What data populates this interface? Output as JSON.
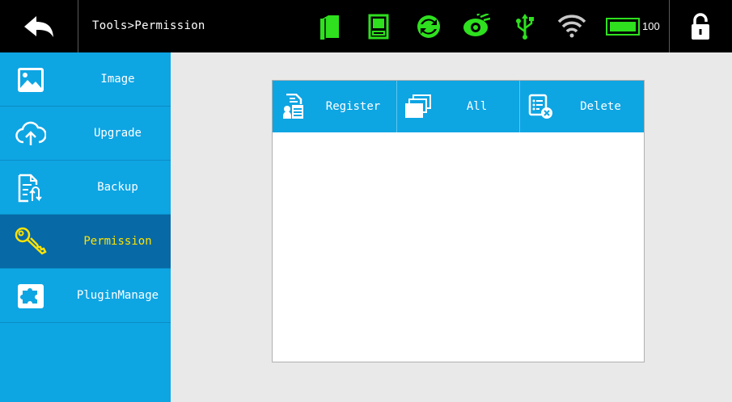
{
  "header": {
    "title": "Tools>Permission",
    "battery_level": "100",
    "status_icons": [
      "printhead-icon",
      "device-icon",
      "sync-icon",
      "eye-icon",
      "usb-icon",
      "wifi-icon",
      "battery-icon"
    ],
    "colors": {
      "status_green": "#2ee01e",
      "background": "#000000"
    }
  },
  "sidebar": {
    "items": [
      {
        "label": "Image",
        "icon": "image-icon"
      },
      {
        "label": "Upgrade",
        "icon": "cloud-upload-icon"
      },
      {
        "label": "Backup",
        "icon": "backup-icon"
      },
      {
        "label": "Permission",
        "icon": "key-icon",
        "active": true
      },
      {
        "label": "PluginManage",
        "icon": "puzzle-icon"
      }
    ],
    "colors": {
      "background": "#0ea5e3",
      "active_background": "#0769a6",
      "active_text": "#ffe300"
    }
  },
  "panel": {
    "tabs": [
      {
        "label": "Register",
        "icon": "register-icon"
      },
      {
        "label": "All",
        "icon": "stack-icon"
      },
      {
        "label": "Delete",
        "icon": "delete-list-icon"
      }
    ],
    "colors": {
      "header": "#0ea5e3"
    }
  }
}
